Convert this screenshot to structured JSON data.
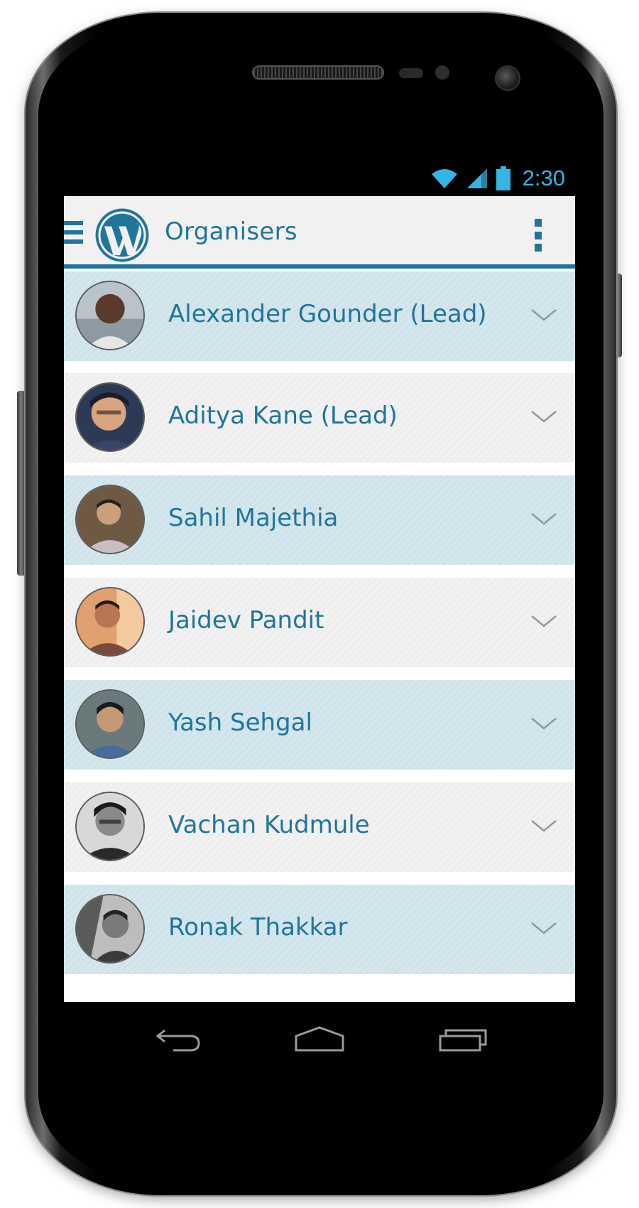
{
  "status_bar": {
    "time": "2:30",
    "icons": [
      "wifi-icon",
      "signal-icon",
      "battery-icon"
    ],
    "accent_color": "#33b5e5"
  },
  "app_bar": {
    "title": "Organisers",
    "icons": [
      "menu-icon",
      "wordpress-logo",
      "overflow-menu-icon"
    ],
    "accent_color": "#21759b"
  },
  "organisers": [
    {
      "name": "Alexander Gounder (Lead)",
      "avatar": "avatar-photo",
      "icon": "chevron-down-icon"
    },
    {
      "name": "Aditya Kane (Lead)",
      "avatar": "avatar-photo",
      "icon": "chevron-down-icon"
    },
    {
      "name": "Sahil Majethia",
      "avatar": "avatar-photo",
      "icon": "chevron-down-icon"
    },
    {
      "name": "Jaidev Pandit",
      "avatar": "avatar-photo",
      "icon": "chevron-down-icon"
    },
    {
      "name": "Yash Sehgal",
      "avatar": "avatar-photo",
      "icon": "chevron-down-icon"
    },
    {
      "name": "Vachan Kudmule",
      "avatar": "avatar-photo",
      "icon": "chevron-down-icon"
    },
    {
      "name": "Ronak Thakkar",
      "avatar": "avatar-photo",
      "icon": "chevron-down-icon"
    }
  ],
  "row_colors": {
    "odd": "#cfe3ea",
    "even": "#eeeeee"
  },
  "nav_bar": {
    "icons": [
      "back-icon",
      "home-icon",
      "recent-apps-icon"
    ]
  }
}
